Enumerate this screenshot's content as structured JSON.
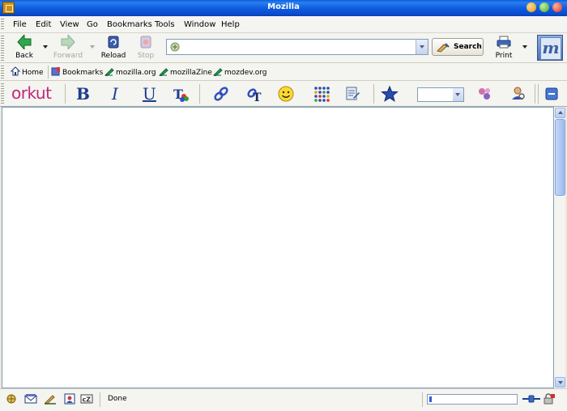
{
  "window": {
    "title": "Mozilla"
  },
  "menu": {
    "items": [
      "File",
      "Edit",
      "View",
      "Go",
      "Bookmarks",
      "Tools",
      "Window",
      "Help"
    ]
  },
  "nav": {
    "back": "Back",
    "forward": "Forward",
    "reload": "Reload",
    "stop": "Stop",
    "url_value": "",
    "search": "Search",
    "print": "Print",
    "forward_enabled": false,
    "stop_enabled": false
  },
  "personal": {
    "items": [
      "Home",
      "Bookmarks",
      "mozilla.org",
      "mozillaZine",
      "mozdev.org"
    ]
  },
  "orkut": {
    "logo": "orkut",
    "bold": "B",
    "italic": "I",
    "underline": "U",
    "combo_value": ""
  },
  "status": {
    "text": "Done",
    "progress": 0.03
  },
  "colors": {
    "titlebar": "#0a5fd8",
    "orkut_brand": "#c0287a",
    "format_buttons": "#1c3c90"
  }
}
